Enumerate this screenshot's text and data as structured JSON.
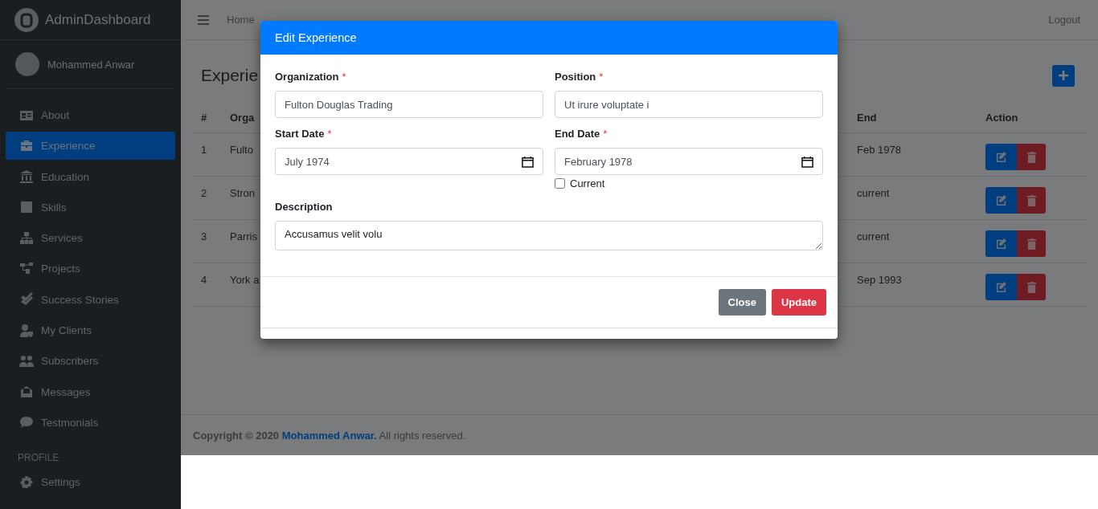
{
  "brand": {
    "name": "AdminDashboard"
  },
  "user": {
    "name": "Mohammed Anwar"
  },
  "sidebar": {
    "items": [
      {
        "label": "About",
        "selected": false
      },
      {
        "label": "Experience",
        "selected": true
      },
      {
        "label": "Education",
        "selected": false
      },
      {
        "label": "Skills",
        "selected": false
      },
      {
        "label": "Services",
        "selected": false
      },
      {
        "label": "Projects",
        "selected": false
      },
      {
        "label": "Success Stories",
        "selected": false
      },
      {
        "label": "My Clients",
        "selected": false
      },
      {
        "label": "Subscribers",
        "selected": false
      },
      {
        "label": "Messages",
        "selected": false
      },
      {
        "label": "Testmonials",
        "selected": false
      }
    ],
    "section": "PROFILE",
    "profile_items": [
      {
        "label": "Settings",
        "selected": false
      }
    ]
  },
  "navbar": {
    "breadcrumb": "Home",
    "logout": "Logout"
  },
  "page": {
    "title": "Experie"
  },
  "table": {
    "columns": [
      "#",
      "Orga",
      "End",
      "Action"
    ],
    "rows": [
      {
        "index": "1",
        "organization": "Fulto",
        "end": "Feb 1978"
      },
      {
        "index": "2",
        "organization": "Stron",
        "end": "current"
      },
      {
        "index": "3",
        "organization": "Parris",
        "end": "current"
      },
      {
        "index": "4",
        "organization": "York a",
        "end": "Sep 1993"
      }
    ]
  },
  "footer": {
    "prefix": "Copyright © 2020",
    "link": "Mohammed Anwar.",
    "suffix": "All rights reserved."
  },
  "modal": {
    "title": "Edit Experience",
    "fields": [
      {
        "kind": "text",
        "label": "Organization",
        "required_mark": "*",
        "value": "Fulton Douglas Trading"
      },
      {
        "kind": "text",
        "label": "Position",
        "required_mark": "*",
        "value": "Ut irure voluptate i"
      },
      {
        "kind": "date",
        "label": "Start Date",
        "required_mark": "*",
        "value": "July 1974"
      },
      {
        "kind": "date",
        "label": "End Date",
        "required_mark": "*",
        "value": "February 1978",
        "checkbox": {
          "label": "Current",
          "checked": false
        }
      },
      {
        "kind": "textarea",
        "label": "Description",
        "value": "Accusamus velit volu"
      }
    ],
    "buttons": [
      {
        "label": "Close",
        "kind": "secondary"
      },
      {
        "label": "Update",
        "kind": "danger"
      }
    ]
  }
}
